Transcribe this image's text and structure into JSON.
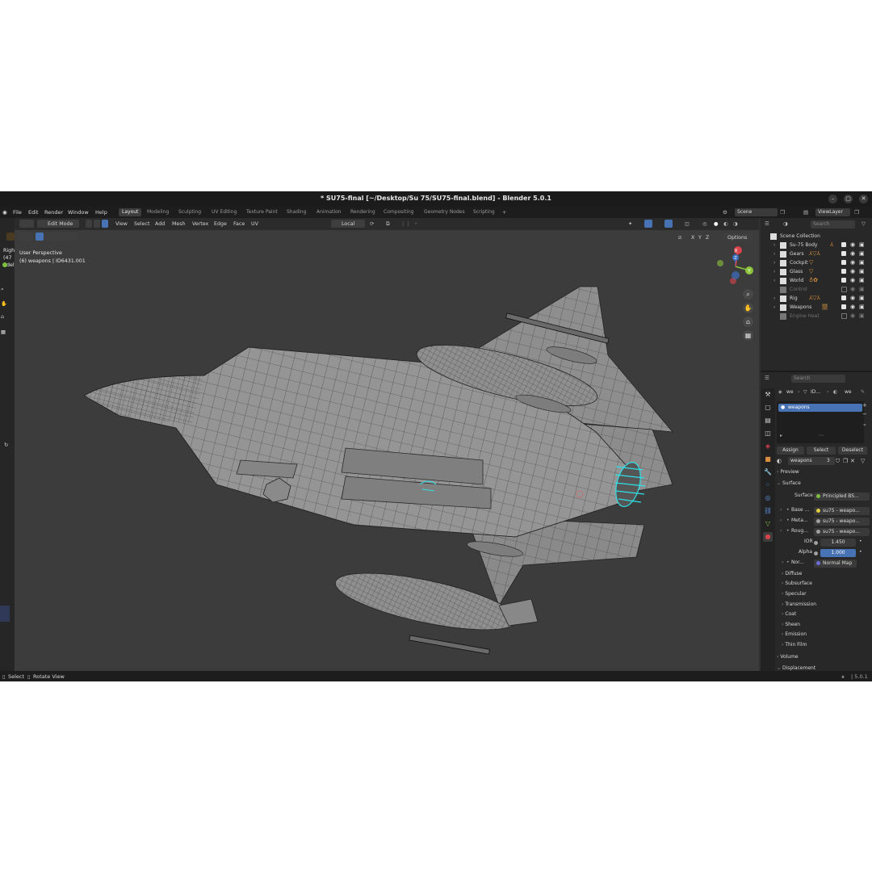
{
  "window": {
    "title": "* SU75-final [~/Desktop/Su 75/SU75-final.blend] - Blender 5.0.1"
  },
  "menu": [
    "File",
    "Edit",
    "Render",
    "Window",
    "Help"
  ],
  "workspaces": [
    "Layout",
    "Modeling",
    "Sculpting",
    "UV Editing",
    "Texture Paint",
    "Shading",
    "Animation",
    "Rendering",
    "Compositing",
    "Geometry Nodes",
    "Scripting"
  ],
  "topright": {
    "scene": "Scene",
    "view_layer": "ViewLayer"
  },
  "viewport_header": {
    "mode": "Edit Mode",
    "menus": [
      "View",
      "Select",
      "Add",
      "Mesh",
      "Vertex",
      "Edge",
      "Face",
      "UV"
    ],
    "orientation": "Local",
    "options": "Options",
    "axes": [
      "X",
      "Y",
      "Z"
    ]
  },
  "viewport_overlay": {
    "perspective": "User Perspective",
    "object_info": "(6) weapons | ID6431.001",
    "left_fragments": [
      "Righ",
      "(47",
      "del"
    ]
  },
  "gizmo": {
    "x": "X",
    "y": "Y",
    "z": "Z"
  },
  "outliner": {
    "search_placeholder": "Search",
    "root": "Scene Collection",
    "rows": [
      {
        "name": "Su-75 Body",
        "active": true
      },
      {
        "name": "Gears",
        "active": true
      },
      {
        "name": "Cockpit",
        "active": true
      },
      {
        "name": "Glass",
        "active": true
      },
      {
        "name": "World",
        "active": true
      },
      {
        "name": "Control",
        "active": false
      },
      {
        "name": "Rig",
        "active": true
      },
      {
        "name": "Weapons",
        "active": true
      },
      {
        "name": "Engine Heat",
        "active": false
      }
    ]
  },
  "properties": {
    "search_placeholder": "Search",
    "breadcrumb": [
      "we",
      "ID...",
      "we"
    ],
    "material_slot": "weapons",
    "buttons": {
      "assign": "Assign",
      "select": "Select",
      "deselect": "Deselect"
    },
    "material_name": "weapons",
    "material_users": "3",
    "sections": {
      "preview": "Preview",
      "surface": "Surface",
      "volume": "Volume",
      "displacement": "Displacement"
    },
    "surface_label": "Surface",
    "surface_value": "Principled BS...",
    "inputs": [
      {
        "label": "Base ...",
        "value": "su75 - weapo..."
      },
      {
        "label": "Meta...",
        "value": "su75 - weapo..."
      },
      {
        "label": "Roug...",
        "value": "su75 - weapo..."
      }
    ],
    "ior": {
      "label": "IOR",
      "value": "1.450"
    },
    "alpha": {
      "label": "Alpha",
      "value": "1.000"
    },
    "normal": {
      "label": "Nor...",
      "value": "Normal Map"
    },
    "subpanels": [
      "Diffuse",
      "Subsurface",
      "Specular",
      "Transmission",
      "Coat",
      "Sheen",
      "Emission",
      "Thin Film"
    ]
  },
  "statusbar": {
    "select": "Select",
    "rotate": "Rotate View",
    "version": "5.0.1"
  },
  "colors": {
    "accent": "#4772b3",
    "mesh": "#8e8e8e",
    "selected": "#2ee0e6",
    "orange": "#d89040"
  }
}
